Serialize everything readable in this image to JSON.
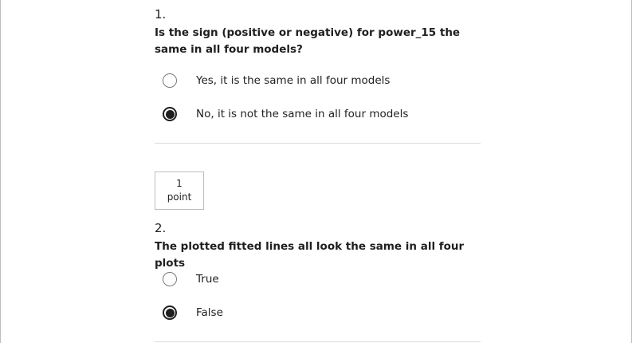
{
  "question1": {
    "number": "1.",
    "text": "Is the sign (positive or negative) for power_15 the same in all four models?",
    "options": [
      {
        "label": "Yes, it is the same in all four models",
        "selected": false
      },
      {
        "label": "No, it is not the same in all four models",
        "selected": true
      }
    ]
  },
  "question2": {
    "points_value": "1",
    "points_unit": "point",
    "number": "2.",
    "text": "The plotted fitted lines all look the same in all four plots",
    "options": [
      {
        "label": "True",
        "selected": false
      },
      {
        "label": "False",
        "selected": true
      }
    ]
  }
}
